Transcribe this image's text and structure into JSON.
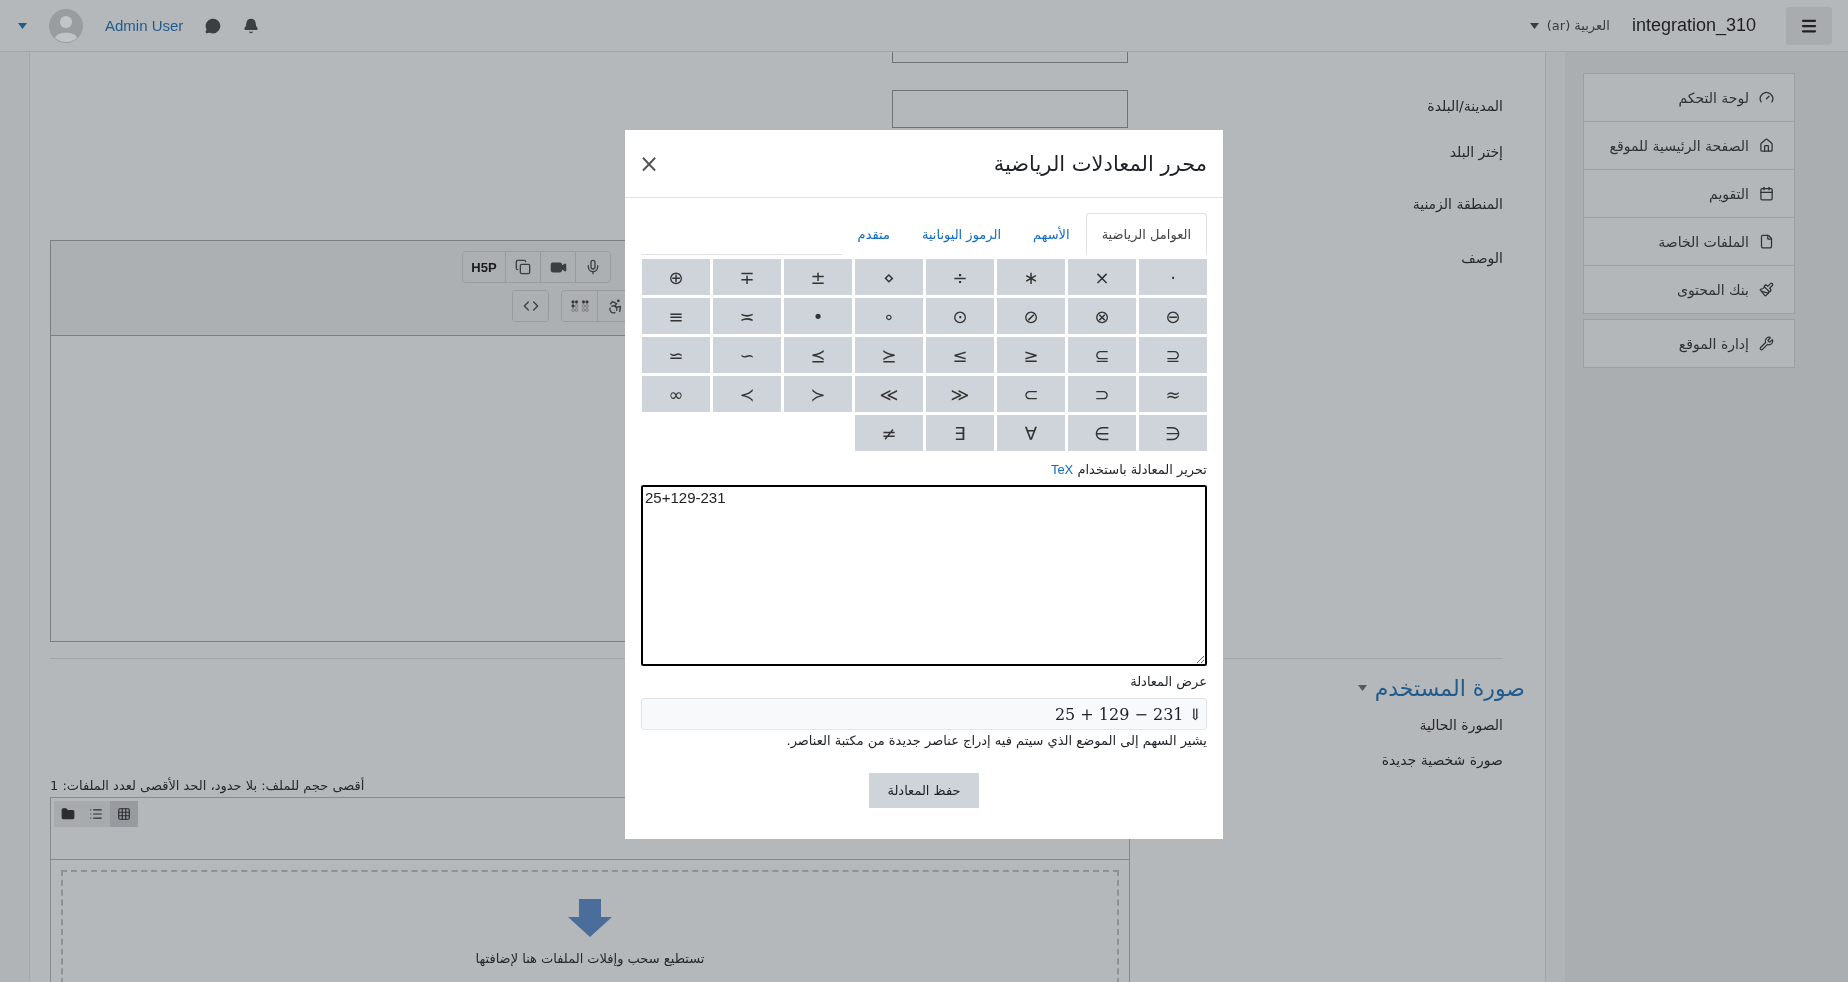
{
  "navbar": {
    "site_name": "integration_310",
    "language": "العربية (ar)",
    "user": "Admin User"
  },
  "drawer": {
    "groups": [
      {
        "items": [
          {
            "label": "لوحة التحكم"
          },
          {
            "label": "الصفحة الرئيسية للموقع"
          },
          {
            "label": "التقويم"
          },
          {
            "label": "الملفات الخاصة"
          },
          {
            "label": "بنك المحتوى"
          }
        ]
      },
      {
        "items": [
          {
            "label": "إدارة الموقع"
          }
        ]
      }
    ]
  },
  "form": {
    "fields": [
      {
        "kind": "input"
      },
      {
        "kind": "input",
        "label": "المدينة/البلدة"
      },
      {
        "kind": "plain",
        "label": "إختر البلد"
      },
      {
        "kind": "plain",
        "label": "المنطقة الزمنية"
      }
    ],
    "description": {
      "label": "الوصف",
      "h5p": "H5P"
    },
    "section": {
      "title": "صورة المستخدم",
      "expanded": true
    },
    "picture_fields": [
      {
        "label": "الصورة الحالية"
      },
      {
        "label": "صورة شخصية جديدة"
      }
    ],
    "file_limits": "أقصى حجم للملف: بلا حدود، الحد الأقصى لعدد الملفات: 1",
    "view_modes": [
      {
        "selected": false
      },
      {
        "selected": false
      },
      {
        "selected": true
      }
    ],
    "drop_hint": "تستطيع سحب وإفلات الملفات هنا لإضافتها"
  },
  "modal": {
    "title": "محرر المعادلات الرياضية",
    "close": "×",
    "tabs": [
      {
        "label": "العوامل الرياضية",
        "selected": true
      },
      {
        "label": "الأسهم",
        "selected": false
      },
      {
        "label": "الرموز اليونانية",
        "selected": false
      },
      {
        "label": "متقدم",
        "selected": false
      }
    ],
    "symbols": [
      "·",
      "×",
      "∗",
      "÷",
      "⋄",
      "±",
      "∓",
      "⊕",
      "⊖",
      "⊗",
      "⊘",
      "⊙",
      "∘",
      "•",
      "≍",
      "≡",
      "⊆",
      "⊇",
      "≤",
      "≥",
      "⪯",
      "⪰",
      "∼",
      "≃",
      "≈",
      "⊂",
      "⊃",
      "≪",
      "≫",
      "≺",
      "≻",
      "∞",
      "∈",
      "∋",
      "∀",
      "∃",
      "≠"
    ],
    "tex_label": "تحرير المعادلة باستخدام",
    "tex_link": "TeX",
    "tex_value": "25+129-231",
    "preview_label": "عرض المعادلة",
    "preview": "25 + 129 − 231 ⇓",
    "help": "يشير السهم إلى الموضع الذي سيتم فيه إدراج عناصر جديدة من مكتبة العناصر.",
    "save": "حفظ المعادلة"
  }
}
